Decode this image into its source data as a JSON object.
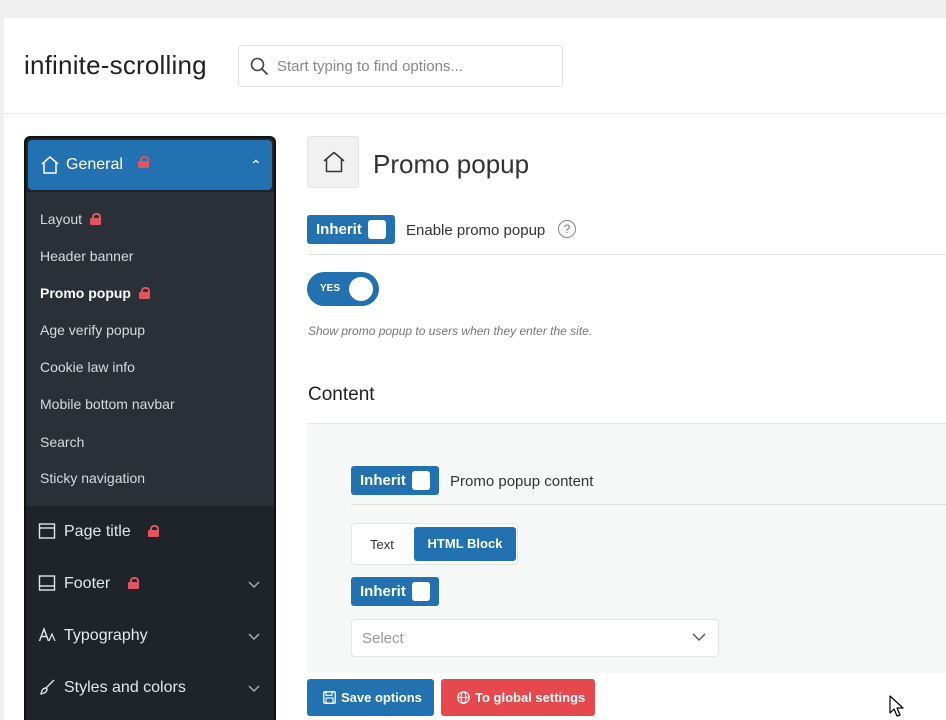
{
  "header": {
    "app_title": "infinite-scrolling",
    "search_placeholder": "Start typing to find options..."
  },
  "sidebar": {
    "general": {
      "label": "General",
      "locked": true,
      "expanded": true
    },
    "sub_items": [
      {
        "label": "Layout",
        "locked": true,
        "active": false
      },
      {
        "label": "Header banner",
        "locked": false,
        "active": false
      },
      {
        "label": "Promo popup",
        "locked": true,
        "active": true
      },
      {
        "label": "Age verify popup",
        "locked": false,
        "active": false
      },
      {
        "label": "Cookie law info",
        "locked": false,
        "active": false
      },
      {
        "label": "Mobile bottom navbar",
        "locked": false,
        "active": false
      },
      {
        "label": "Search",
        "locked": false,
        "active": false
      },
      {
        "label": "Sticky navigation",
        "locked": false,
        "active": false
      }
    ],
    "sections": [
      {
        "label": "Page title",
        "icon": "page-title-icon",
        "locked": true,
        "has_chevron": false
      },
      {
        "label": "Footer",
        "icon": "footer-icon",
        "locked": true,
        "has_chevron": true
      },
      {
        "label": "Typography",
        "icon": "typography-icon",
        "locked": false,
        "has_chevron": true
      },
      {
        "label": "Styles and colors",
        "icon": "brush-icon",
        "locked": false,
        "has_chevron": true
      }
    ]
  },
  "main": {
    "page_title": "Promo popup",
    "enable": {
      "inherit_label": "Inherit",
      "label": "Enable promo popup",
      "help": "?",
      "toggle_label": "YES",
      "toggle_on": true,
      "description": "Show promo popup to users when they enter the site."
    },
    "content": {
      "heading": "Content",
      "inherit_label": "Inherit",
      "label": "Promo popup content",
      "options": [
        "Text",
        "HTML Block"
      ],
      "selected_option": "HTML Block",
      "inherit_label_2": "Inherit",
      "select_value": "Select"
    }
  },
  "footer": {
    "save_label": "Save options",
    "global_label": "To global settings"
  },
  "colors": {
    "accent": "#2271b1",
    "danger": "#e5484d",
    "sidebar_bg": "#1f242b",
    "lock": "#e05560"
  }
}
